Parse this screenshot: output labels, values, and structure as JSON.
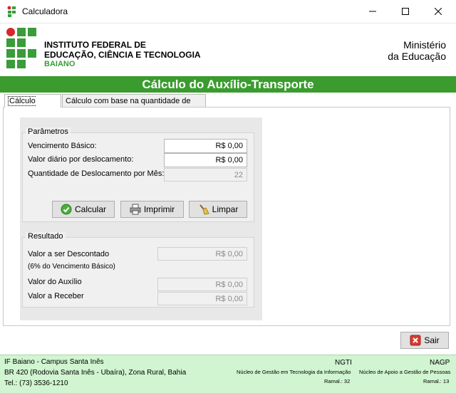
{
  "window": {
    "title": "Calculadora"
  },
  "header": {
    "institute_line1": "INSTITUTO FEDERAL DE",
    "institute_line2": "EDUCAÇÃO, CIÊNCIA E TECNOLOGIA",
    "institute_line3": "BAIANO",
    "ministry_line1": "Ministério",
    "ministry_line2": "da Educação"
  },
  "banner": "Cálculo do Auxílio-Transporte",
  "tabs": [
    "Cálculo mensal",
    "Cálculo com base na quantidade de dias"
  ],
  "params": {
    "legend": "Parâmetros",
    "vencimento_label": "Vencimento Básico:",
    "vencimento_value": "R$ 0,00",
    "valor_diario_label": "Valor diário por deslocamento:",
    "valor_diario_value": "R$ 0,00",
    "qtd_label": "Quantidade de Deslocamento por Mês:",
    "qtd_value": "22"
  },
  "buttons": {
    "calcular": "Calcular",
    "imprimir": "Imprimir",
    "limpar": "Limpar",
    "sair": "Sair"
  },
  "resultado": {
    "legend": "Resultado",
    "descontado_label": "Valor a ser Descontado",
    "descontado_note": "(6% do Vencimento Básico)",
    "descontado_value": "R$ 0,00",
    "auxilio_label": "Valor do Auxílio",
    "auxilio_value": "R$ 0,00",
    "receber_label": "Valor a Receber",
    "receber_value": "R$ 0,00"
  },
  "footer": {
    "campus": "IF Baiano - Campus Santa Inês",
    "address": "BR 420 (Rodovia Santa Inês - Ubaíra), Zona Rural, Bahia",
    "phone": "Tel.: (73) 3536-1210",
    "ngti_title": "NGTI",
    "ngti_desc": "Núcleo de Gestão em Tecnologia da Informação",
    "ngti_ramal": "Ramal.: 32",
    "nagp_title": "NAGP",
    "nagp_desc": "Núcleo de Apoio a Gestão de Pessoas",
    "nagp_ramal": "Ramal.: 13"
  },
  "colors": {
    "brand_green": "#3a9c2e",
    "logo_red": "#d9262c",
    "footer_bg": "#d0f5d0"
  }
}
